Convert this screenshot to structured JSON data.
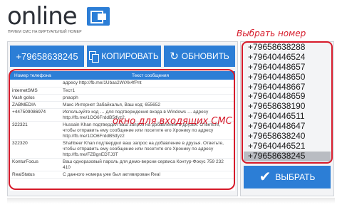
{
  "logo": {
    "word": "online",
    "tagline": "ПРИЕМ СМС НА ВИРТУАЛЬНЫЙ НОМЕР"
  },
  "toolbar": {
    "number": "+79658638245",
    "copy_label": "КОПИРОВАТЬ",
    "refresh_label": "ОБНОВИТЬ"
  },
  "table": {
    "headers": [
      "Номер телефона",
      "Текст сообщения"
    ],
    "rows": [
      {
        "sender": "",
        "text": "адресу http://fb.me/1Ubas2WrXk4fPnt"
      },
      {
        "sender": "internetSMS",
        "text": "Тест1"
      },
      {
        "sender": "Vash golos",
        "text": "pnaoph"
      },
      {
        "sender": "ZABMEDIA",
        "text": "Макс Интернет Забайкалья, Ваш код: 655652"
      },
      {
        "sender": "+447509086974",
        "text": "Используйте код … для подтверждения входа в Windows … адресу http://fb.me/1OO6FrddB5tfyz2"
      },
      {
        "sender": "322321",
        "text": "Hussain Khan подтвердил ваш запрос на добавление в друзья. Ответьте, чтобы отправить ему сообщение или посетите его Хронику по адресу http://fb.me/1OO6FrddB5tfyz2"
      },
      {
        "sender": "322320",
        "text": "Shahbeer Khan подтвердил ваш запрос на добавление в друзья. Ответьте, чтобы отправить ему сообщение или посетите его Хронику по адресу http://fb.me/FZBgnEDTJ3T"
      },
      {
        "sender": "KonturFocus",
        "text": "Ваш одноразовый пароль для демо-версии сервиса Контур-Фокус 759 232 410"
      },
      {
        "sender": "RealStatus",
        "text": "С данного номера уже был активирован Real"
      }
    ]
  },
  "annotations": {
    "inbox_label": "окно для входящих СМС",
    "choose_number_label": "Выбрать номер"
  },
  "numbers": {
    "items": [
      "+79658638288",
      "+79640446524",
      "+79640448657",
      "+79640448650",
      "+79640448667",
      "+79640448659",
      "+79658638190",
      "+79640446511",
      "+79640448647",
      "+79658638240",
      "+79640446521",
      "+79658638245"
    ],
    "selected": "+79658638245"
  },
  "choose_button": {
    "label": "ВЫБРАТЬ"
  },
  "colors": {
    "accent": "#2c7ed6",
    "annotation": "#d61a2a",
    "panel": "#f3f4f6"
  }
}
